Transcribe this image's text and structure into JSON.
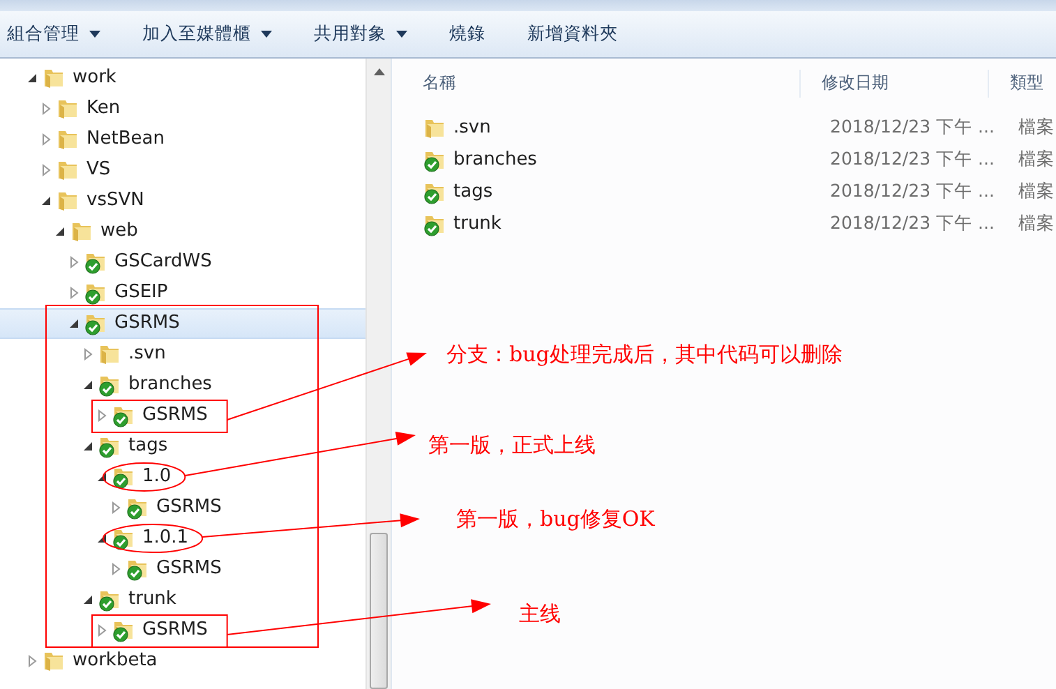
{
  "toolbar": [
    {
      "label": "組合管理",
      "dropdown": true
    },
    {
      "label": "加入至媒體櫃",
      "dropdown": true
    },
    {
      "label": "共用對象",
      "dropdown": true
    },
    {
      "label": "燒錄",
      "dropdown": false
    },
    {
      "label": "新增資料夾",
      "dropdown": false
    }
  ],
  "tree": [
    {
      "name": "work",
      "kind": "folder",
      "expanded": true,
      "selected": false,
      "children": [
        {
          "name": "Ken",
          "kind": "folder",
          "expanded": false,
          "selected": false
        },
        {
          "name": "NetBean",
          "kind": "folder",
          "expanded": false,
          "selected": false
        },
        {
          "name": "VS",
          "kind": "folder",
          "expanded": false,
          "selected": false
        },
        {
          "name": "vsSVN",
          "kind": "folder",
          "expanded": true,
          "selected": false,
          "children": [
            {
              "name": "web",
              "kind": "folder",
              "expanded": true,
              "selected": false,
              "children": [
                {
                  "name": "GSCardWS",
                  "kind": "svn",
                  "expanded": false,
                  "selected": false
                },
                {
                  "name": "GSEIP",
                  "kind": "svn",
                  "expanded": false,
                  "selected": false
                },
                {
                  "name": "GSRMS",
                  "kind": "svn",
                  "expanded": true,
                  "selected": true,
                  "framed": true,
                  "children": [
                    {
                      "name": ".svn",
                      "kind": "folder",
                      "expanded": false,
                      "selected": false
                    },
                    {
                      "name": "branches",
                      "kind": "svn",
                      "expanded": true,
                      "selected": false,
                      "children": [
                        {
                          "name": "GSRMS",
                          "kind": "svn",
                          "expanded": false,
                          "selected": false,
                          "callout": {
                            "kind": "box",
                            "text": "分支：bug处理完成后，其中代码可以删除"
                          }
                        }
                      ]
                    },
                    {
                      "name": "tags",
                      "kind": "svn",
                      "expanded": true,
                      "selected": false,
                      "children": [
                        {
                          "name": "1.0",
                          "kind": "svn",
                          "expanded": true,
                          "selected": false,
                          "callout": {
                            "kind": "ellipse",
                            "text": "第一版，正式上线"
                          },
                          "children": [
                            {
                              "name": "GSRMS",
                              "kind": "svn",
                              "expanded": false,
                              "selected": false
                            }
                          ]
                        },
                        {
                          "name": "1.0.1",
                          "kind": "svn",
                          "expanded": true,
                          "selected": false,
                          "callout": {
                            "kind": "ellipse",
                            "text": "第一版，bug修复OK"
                          },
                          "children": [
                            {
                              "name": "GSRMS",
                              "kind": "svn",
                              "expanded": false,
                              "selected": false
                            }
                          ]
                        }
                      ]
                    },
                    {
                      "name": "trunk",
                      "kind": "svn",
                      "expanded": true,
                      "selected": false,
                      "children": [
                        {
                          "name": "GSRMS",
                          "kind": "svn",
                          "expanded": false,
                          "selected": false,
                          "callout": {
                            "kind": "box",
                            "text": "主线"
                          }
                        }
                      ]
                    }
                  ]
                }
              ]
            }
          ]
        }
      ]
    },
    {
      "name": "workbeta",
      "kind": "folder",
      "expanded": false,
      "selected": false
    }
  ],
  "columns": [
    "名稱",
    "修改日期",
    "類型"
  ],
  "files": [
    {
      "name": ".svn",
      "kind": "folder",
      "modified": "2018/12/23 下午 ...",
      "type": "檔案"
    },
    {
      "name": "branches",
      "kind": "svn",
      "modified": "2018/12/23 下午 ...",
      "type": "檔案"
    },
    {
      "name": "tags",
      "kind": "svn",
      "modified": "2018/12/23 下午 ...",
      "type": "檔案"
    },
    {
      "name": "trunk",
      "kind": "svn",
      "modified": "2018/12/23 下午 ...",
      "type": "檔案"
    }
  ]
}
